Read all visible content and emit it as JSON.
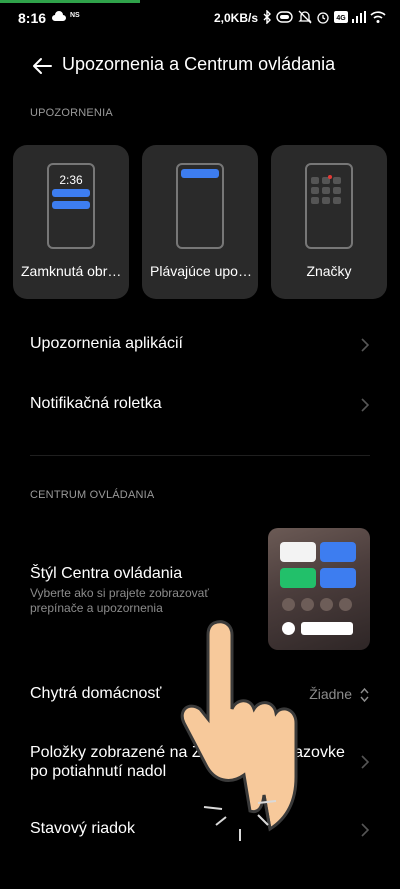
{
  "status_bar": {
    "time": "8:16",
    "ns_label": "NS",
    "net_speed": "2,0KB/s",
    "progress_fraction": 0.35,
    "icons": [
      "cloud-icon",
      "bluetooth-icon",
      "battery-saver-icon",
      "mute-icon",
      "alarm-icon",
      "volte-icon",
      "signal-icon",
      "wifi-icon"
    ]
  },
  "header": {
    "title": "Upozornenia a Centrum ovládania"
  },
  "notifications": {
    "section_label": "UPOZORNENIA",
    "cards": [
      {
        "label": "Zamknutá obr…",
        "clock": "2:36"
      },
      {
        "label": "Plávajúce upo…"
      },
      {
        "label": "Značky"
      }
    ],
    "rows": [
      {
        "title": "Upozornenia aplikácií"
      },
      {
        "title": "Notifikačná roletka"
      }
    ]
  },
  "control_center": {
    "section_label": "CENTRUM OVLÁDANIA",
    "style": {
      "title": "Štýl Centra ovládania",
      "subtitle": "Vyberte ako si prajete zobrazovať prepínače a upozornenia"
    },
    "smart_home": {
      "title": "Chytrá domácnosť",
      "value": "Žiadne"
    },
    "lock_screen_items": {
      "title": "Položky zobrazené na Zamknutej obrazovke po potiahnutí nadol"
    },
    "status_bar_row": {
      "title": "Stavový riadok"
    }
  },
  "colors": {
    "accent": "#3d7df0",
    "green": "#22c06a",
    "background": "#000000",
    "card": "#2a2a2a"
  }
}
